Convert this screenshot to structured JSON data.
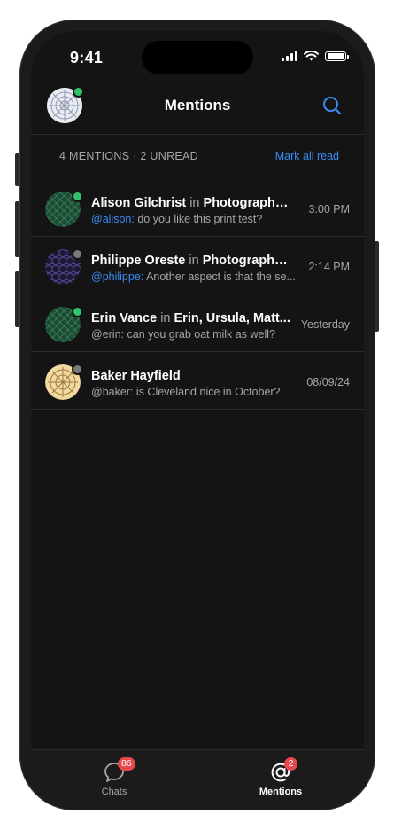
{
  "status": {
    "time": "9:41"
  },
  "header": {
    "title": "Mentions",
    "avatar_online": true
  },
  "subbar": {
    "count_text": "4 MENTIONS · 2 UNREAD",
    "mark_all_label": "Mark all read"
  },
  "mentions": [
    {
      "name": "Alison Gilchrist",
      "in_word": "in",
      "channel": "Photographers",
      "handle": "@alison:",
      "message": "do you like this print test?",
      "time": "3:00 PM",
      "online": true,
      "unread": true,
      "avatar": "green-lattice"
    },
    {
      "name": "Philippe Oreste",
      "in_word": "in",
      "channel": "Photographers",
      "handle": "@philippe:",
      "message": "Another aspect is that the se...",
      "time": "2:14 PM",
      "online": false,
      "unread": true,
      "avatar": "purple-hex"
    },
    {
      "name": "Erin Vance",
      "in_word": "in",
      "channel": "Erin, Ursula, Matt...",
      "handle": "@erin:",
      "message": "can you grab oat milk as well?",
      "time": "Yesterday",
      "online": true,
      "unread": false,
      "avatar": "green-lattice"
    },
    {
      "name": "Baker Hayfield",
      "in_word": "",
      "channel": "",
      "handle": "@baker:",
      "message": "is Cleveland nice in October?",
      "time": "08/09/24",
      "online": false,
      "unread": false,
      "avatar": "cream-web"
    }
  ],
  "tabs": [
    {
      "label": "Chats",
      "badge": "86",
      "icon": "chat-bubble-icon",
      "active": false
    },
    {
      "label": "Mentions",
      "badge": "2",
      "icon": "at-sign-icon",
      "active": true
    }
  ],
  "colors": {
    "accent": "#3b8df5",
    "online": "#33c46b",
    "offline": "#7a7a7a",
    "badge": "#e5484d",
    "background": "#141414"
  }
}
